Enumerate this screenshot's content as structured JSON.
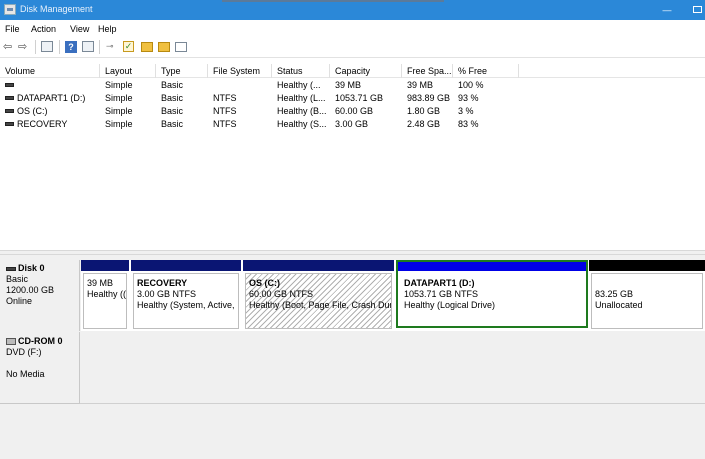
{
  "window": {
    "title": "Disk Management",
    "min_glyph": "—"
  },
  "menu": [
    "File",
    "Action",
    "View",
    "Help"
  ],
  "toolbar": {
    "back": "⇦",
    "forward": "⇨",
    "help": "?",
    "check": "✓",
    "key": "⊸"
  },
  "columns": [
    "Volume",
    "Layout",
    "Type",
    "File System",
    "Status",
    "Capacity",
    "Free Spa...",
    "% Free"
  ],
  "volumes": [
    {
      "volume": "",
      "layout": "Simple",
      "type": "Basic",
      "fs": "",
      "status": "Healthy (...",
      "capacity": "39 MB",
      "free": "39 MB",
      "pct": "100 %"
    },
    {
      "volume": "DATAPART1 (D:)",
      "layout": "Simple",
      "type": "Basic",
      "fs": "NTFS",
      "status": "Healthy (L...",
      "capacity": "1053.71 GB",
      "free": "983.89 GB",
      "pct": "93 %"
    },
    {
      "volume": "OS (C:)",
      "layout": "Simple",
      "type": "Basic",
      "fs": "NTFS",
      "status": "Healthy (B...",
      "capacity": "60.00 GB",
      "free": "1.80 GB",
      "pct": "3 %"
    },
    {
      "volume": "RECOVERY",
      "layout": "Simple",
      "type": "Basic",
      "fs": "NTFS",
      "status": "Healthy (S...",
      "capacity": "3.00 GB",
      "free": "2.48 GB",
      "pct": "83 %"
    }
  ],
  "disk0": {
    "name": "Disk 0",
    "type": "Basic",
    "size": "1200.00 GB",
    "state": "Online"
  },
  "partitions": [
    {
      "name": "",
      "size": "39 MB",
      "status": "Healthy (("
    },
    {
      "name": "RECOVERY",
      "size": "3.00 GB NTFS",
      "status": "Healthy (System, Active,"
    },
    {
      "name": "OS  (C:)",
      "size": "60.00 GB NTFS",
      "status": "Healthy (Boot, Page File, Crash Dum"
    },
    {
      "name": "DATAPART1  (D:)",
      "size": "1053.71 GB NTFS",
      "status": "Healthy (Logical Drive)"
    },
    {
      "name": "",
      "size": "83.25 GB",
      "status": "Unallocated"
    }
  ],
  "cdrom": {
    "name": "CD-ROM 0",
    "drive": "DVD (F:)",
    "media": "No Media"
  },
  "colors": {
    "primary_bar": "#0a1573",
    "logical_bar": "#0000e6",
    "unallocated_bar": "#000000",
    "selection": "#1e7a1e",
    "titlebar": "#2b88d8"
  }
}
